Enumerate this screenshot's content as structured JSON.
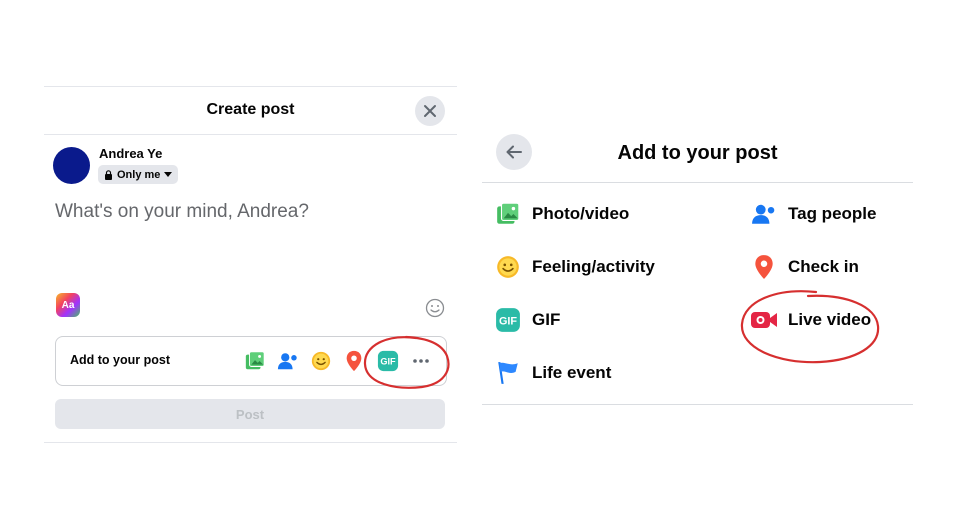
{
  "create_post": {
    "title": "Create post",
    "user_name": "Andrea Ye",
    "privacy_label": "Only me",
    "composer_placeholder": "What's on your mind, Andrea?",
    "text_format_label": "Aa",
    "add_to_post_label": "Add to your post",
    "gif_label": "GIF",
    "more_label": "•••",
    "post_button_label": "Post",
    "icons": [
      "photo-video-icon",
      "tag-people-icon",
      "feeling-icon",
      "check-in-icon",
      "gif-icon",
      "more-icon"
    ]
  },
  "add_to_post": {
    "title": "Add to your post",
    "options": [
      {
        "label": "Photo/video",
        "icon": "photo-video-icon"
      },
      {
        "label": "Tag people",
        "icon": "tag-people-icon"
      },
      {
        "label": "Feeling/activity",
        "icon": "feeling-icon"
      },
      {
        "label": "Check in",
        "icon": "check-in-icon"
      },
      {
        "label": "GIF",
        "icon": "gif-icon"
      },
      {
        "label": "Live video",
        "icon": "live-video-icon"
      },
      {
        "label": "Life event",
        "icon": "life-event-icon"
      }
    ]
  },
  "colors": {
    "photo_green": "#45bd62",
    "tag_blue": "#1877f2",
    "feeling_yellow": "#f7b928",
    "checkin_red": "#f5533d",
    "gif_teal": "#2abba7",
    "live_red": "#e42645",
    "annotation_red": "#d62f2f"
  }
}
